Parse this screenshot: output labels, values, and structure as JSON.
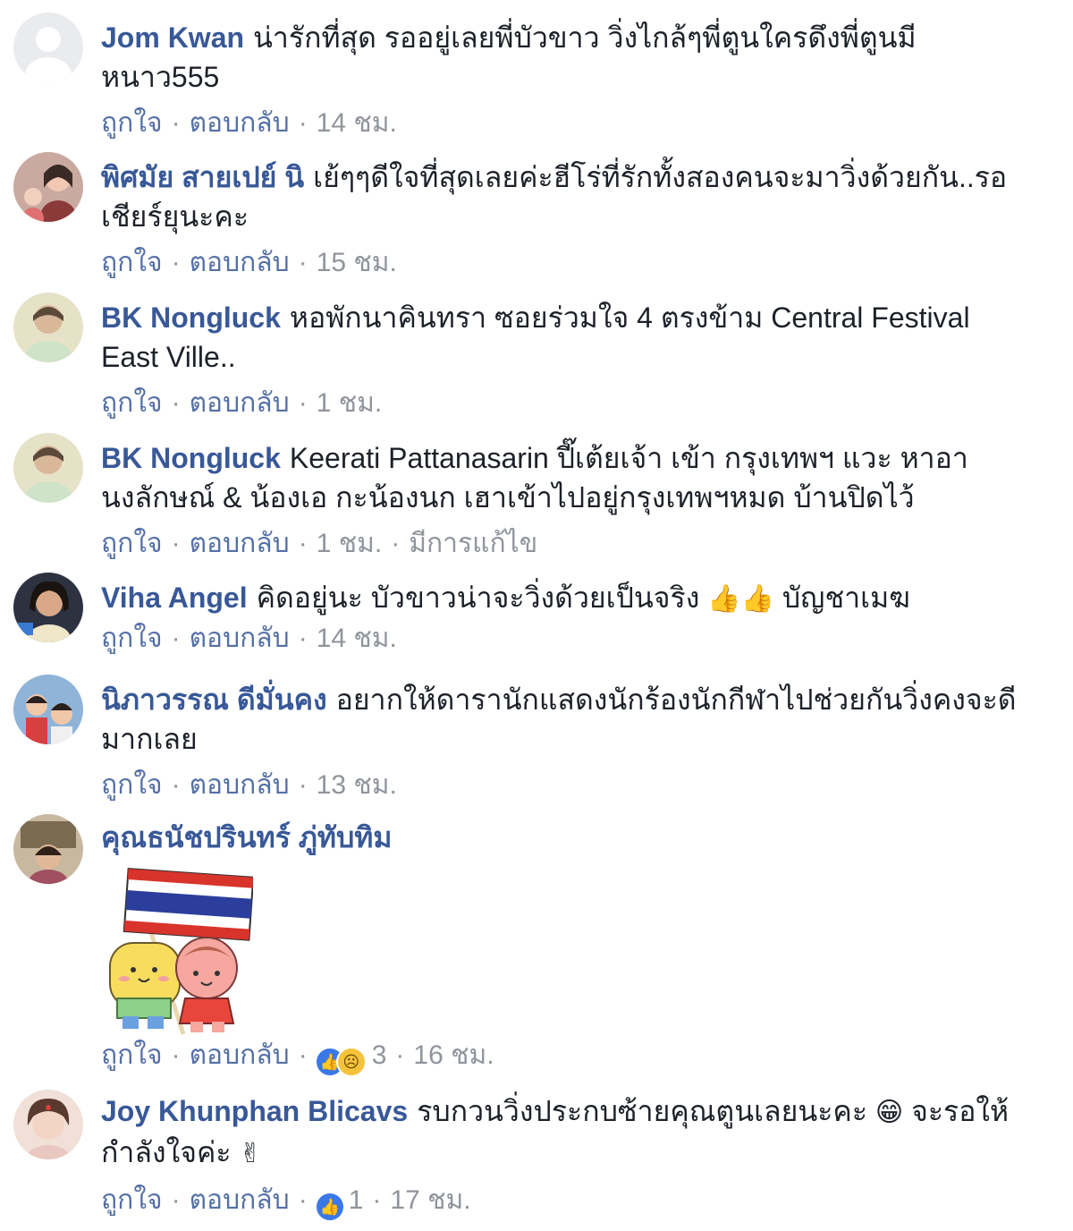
{
  "actions": {
    "like": "ถูกใจ",
    "reply": "ตอบกลับ",
    "separator": "·"
  },
  "comments": [
    {
      "author": "Jom Kwan",
      "text": "น่ารักที่สุด รออยู่เลยพี่บัวขาว วิ่งไกล้ๆพี่ตูนใครดึงพี่ตูนมีหนาว555",
      "time": "14 ชม."
    },
    {
      "author": "พิศมัย สายเปย์ นิ",
      "text": "เย้ๆๆดีใจที่สุดเลยค่ะฮีโร่ที่รักทั้งสองคนจะมาวิ่งด้วยกัน..รอเชียร์ยุนะคะ",
      "time": "15 ชม."
    },
    {
      "author": "BK Nongluck",
      "text": "หอพักนาคินทรา ซอยร่วมใจ 4 ตรงข้าม Central Festival East Ville..",
      "time": "1 ชม."
    },
    {
      "author": "BK Nongluck",
      "text": "Keerati Pattanasarin ปี๊เต้ยเจ้า เข้า กรุงเทพฯ แวะ หาอานงลักษณ์ & น้องเอ กะน้องนก เฮาเข้าไปอยู่กรุงเทพฯหมด บ้านปิดไว้",
      "time": "1 ชม.",
      "edited": "มีการแก้ไข"
    },
    {
      "author": "Viha Angel",
      "text": "คิดอยู่นะ บัวขาวน่าจะวิ่งด้วยเป็นจริง",
      "emoji": "👍👍",
      "text_after": "บัญชาเมฆ",
      "time": "14 ชม."
    },
    {
      "author": "นิภาวรรณ ดีมั่นคง",
      "text": "อยากให้ดารานักแสดงนักร้องนักกีฬาไปช่วยกันวิ่งคงจะดีมากเลย",
      "time": "13 ชม."
    },
    {
      "author": "คุณธนัชปรินทร์ ภู่ทับทิม",
      "text": "",
      "time": "16 ชม.",
      "reaction_count": "3"
    },
    {
      "author": "Joy Khunphan Blicavs",
      "text": "รบกวนวิ่งประกบซ้ายคุณตูนเลยนะคะ",
      "emoji": "😁",
      "text_after": "จะรอให้กำลังใจค่ะ",
      "emoji2": "✌",
      "time": "17 ชม.",
      "reaction_count": "1"
    }
  ],
  "colors": {
    "author": "#385898",
    "text": "#1d2129",
    "meta": "#90949c",
    "like_reaction": "#3b78e7",
    "sad_reaction": "#f5c33b"
  },
  "icons": {
    "like_reaction": "thumbs-up-icon",
    "sad_reaction": "sad-face-icon"
  }
}
